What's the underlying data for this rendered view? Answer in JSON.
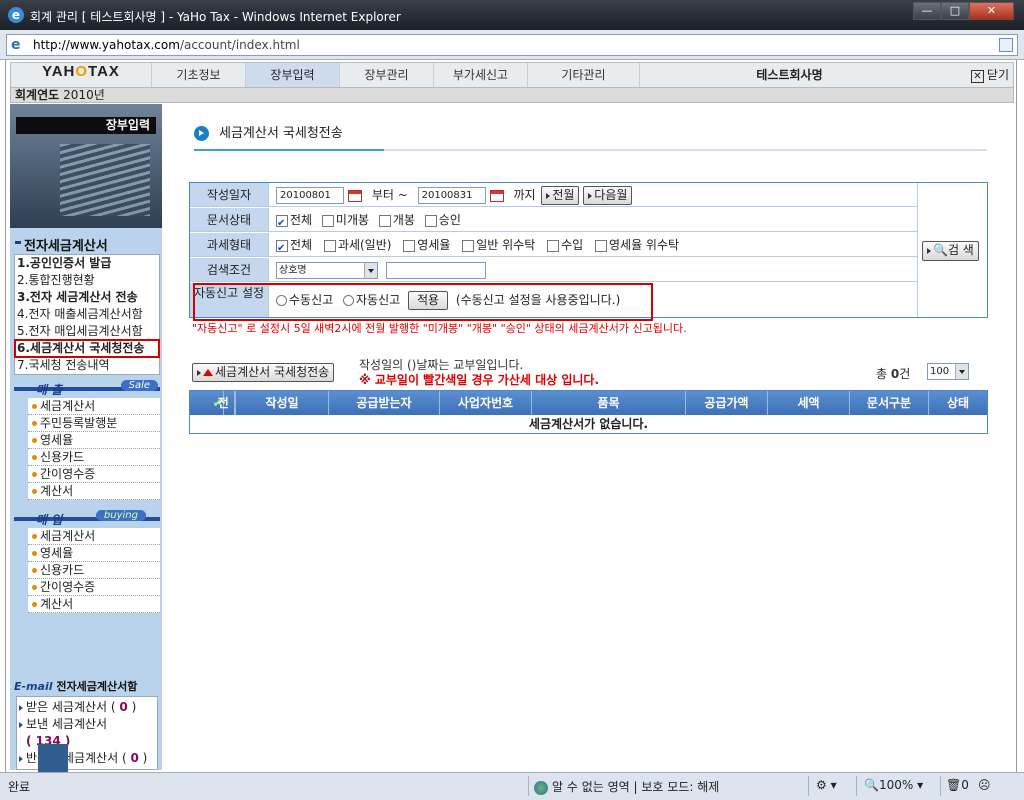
{
  "window": {
    "title": "회계 관리 [ 테스트회사명 ] - YaHo Tax - Windows Internet Explorer",
    "url_prefix": "http://www.yahotax.com",
    "url_path": "/account/index.html"
  },
  "nav": {
    "logo_a": "YAH",
    "logo_o": "O",
    "logo_b": "TAX",
    "tabs": [
      "기초정보",
      "장부입력",
      "장부관리",
      "부가세신고",
      "기타관리"
    ],
    "active_tab": "장부입력",
    "company": "테스트회사명",
    "close": "닫기"
  },
  "year": {
    "label": "회계연도",
    "value": "2010년"
  },
  "sidebar": {
    "head_label": "장부입력",
    "title": "전자세금계산서",
    "menu": [
      "1.공인인증서 발급",
      "2.통합진행현황",
      "3.전자 세금계산서 전송",
      "4.전자 매출세금계산서함",
      "5.전자 매입세금계산서함",
      "6.세금계산서 국세청전송",
      "7.국세청 전송내역"
    ],
    "sales": {
      "title": "매 출",
      "tag": "Sale",
      "items": [
        "세금계산서",
        "주민등록발행분",
        "영세율",
        "신용카드",
        "간이영수증",
        "계산서"
      ]
    },
    "buying": {
      "title": "매 입",
      "tag": "buying",
      "items": [
        "세금계산서",
        "영세율",
        "신용카드",
        "간이영수증",
        "계산서"
      ]
    },
    "email": {
      "title_a": "E-mail",
      "title_b": "전자세금계산서함",
      "received": "받은 세금계산서 (",
      "received_count": "0",
      "sent": "보낸 세금계산서",
      "sent_count": "( 134 )",
      "returned": "반송된 세금계산서 (",
      "returned_count": "0"
    }
  },
  "main": {
    "title": "세금계산서 국세청전송",
    "form": {
      "date_label": "작성일자",
      "date_from": "20100801",
      "from_suffix": "부터 ~",
      "date_to": "20100831",
      "to_suffix": "까지",
      "prev_month": "전월",
      "next_month": "다음월",
      "docstate_label": "문서상태",
      "docstate_opts": [
        "전체",
        "미개봉",
        "개봉",
        "승인"
      ],
      "taxtype_label": "과세형태",
      "taxtype_opts": [
        "전체",
        "과세(일반)",
        "영세율",
        "일반 위수탁",
        "수입",
        "영세율 위수탁"
      ],
      "search_label": "검색조건",
      "search_field": "상호명",
      "search_value": "",
      "auto_label": "자동신고 설정",
      "manual": "수동신고",
      "auto": "자동신고",
      "apply": "적용",
      "auto_status": "(수동신고 설정을 사용중입니다.)",
      "search_button": "검 색"
    },
    "red_note": "\"자동신고\" 로 설정시 5일 새벽2시에 전월 발행한 \"미개봉\" \"개봉\" \"승인\" 상태의 세금계산서가 신고됩니다.",
    "submit_button": "세금계산서 국세청전송",
    "info1": "작성일의 ()날짜는 교부일입니다.",
    "info2": "※ 교부일이 빨간색일 경우 가산세 대상 입니다.",
    "total_label": "총",
    "total_count": "0",
    "total_unit": "건",
    "page_size": "100",
    "columns": [
      "전체",
      "작성일",
      "공급받는자",
      "사업자번호",
      "품목",
      "공급가액",
      "세액",
      "문서구분",
      "상태"
    ],
    "empty": "세금계산서가 없습니다."
  },
  "status": {
    "left": "완료",
    "zone": "알 수 없는 영역 | 보호 모드: 해제",
    "zoom": "100%",
    "count": "0"
  }
}
